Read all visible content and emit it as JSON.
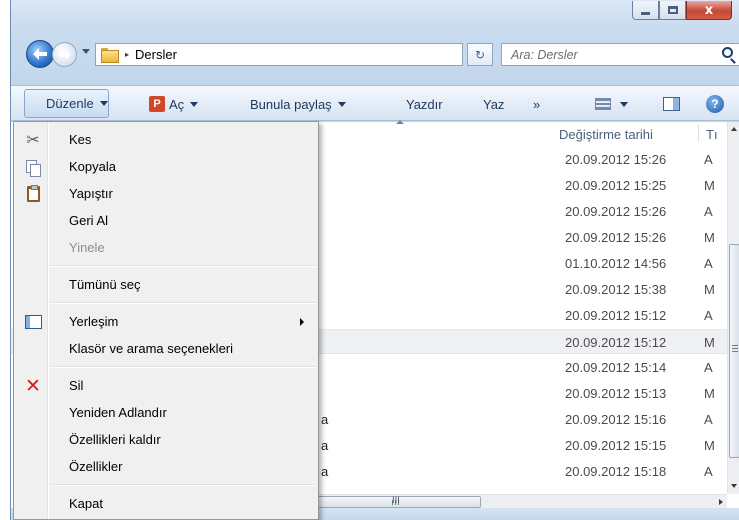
{
  "window": {
    "caption_buttons": {
      "minimize_icon": "minimize-icon",
      "maximize_icon": "maximize-icon",
      "close_glyph": "x"
    }
  },
  "address_bar": {
    "path": "Dersler",
    "separator": "▸",
    "refresh_glyph": "↻",
    "search_placeholder": "Ara: Dersler"
  },
  "command_bar": {
    "organize": "Düzenle",
    "open": "Aç",
    "open_icon_letter": "P",
    "share": "Bunula paylaş",
    "print": "Yazdır",
    "burn": "Yaz",
    "more": "»",
    "help": "?"
  },
  "columns": {
    "modified": "Değiştirme tarihi",
    "type": "Tı"
  },
  "files": [
    {
      "modified": "20.09.2012 15:26",
      "type": "A",
      "name_fragment": ""
    },
    {
      "modified": "20.09.2012 15:25",
      "type": "M",
      "name_fragment": ""
    },
    {
      "modified": "20.09.2012 15:26",
      "type": "A",
      "name_fragment": ""
    },
    {
      "modified": "20.09.2012 15:26",
      "type": "M",
      "name_fragment": ""
    },
    {
      "modified": "01.10.2012 14:56",
      "type": "A",
      "name_fragment": ""
    },
    {
      "modified": "20.09.2012 15:38",
      "type": "M",
      "name_fragment": ""
    },
    {
      "modified": "20.09.2012 15:12",
      "type": "A",
      "name_fragment": ""
    },
    {
      "modified": "20.09.2012 15:12",
      "type": "M",
      "name_fragment": ""
    },
    {
      "modified": "20.09.2012 15:14",
      "type": "A",
      "name_fragment": ""
    },
    {
      "modified": "20.09.2012 15:13",
      "type": "M",
      "name_fragment": ""
    },
    {
      "modified": "20.09.2012 15:16",
      "type": "A",
      "name_fragment": "a"
    },
    {
      "modified": "20.09.2012 15:15",
      "type": "M",
      "name_fragment": "a"
    },
    {
      "modified": "20.09.2012 15:18",
      "type": "A",
      "name_fragment": "a"
    }
  ],
  "selected_row_index": 7,
  "hscroll_grip": "III",
  "menu": {
    "cut": "Kes",
    "copy": "Kopyala",
    "paste": "Yapıştır",
    "undo": "Geri Al",
    "redo": "Yinele",
    "select_all": "Tümünü seç",
    "layout": "Yerleşim",
    "folder_options": "Klasör ve arama seçenekleri",
    "delete": "Sil",
    "rename": "Yeniden Adlandır",
    "remove_properties": "Özellikleri kaldır",
    "properties": "Özellikler",
    "close": "Kapat",
    "delete_glyph": "✕",
    "cut_glyph": "✂"
  },
  "colors": {
    "accent": "#1e395b",
    "delete_icon": "#d4211f",
    "close_button": "#c64838"
  }
}
